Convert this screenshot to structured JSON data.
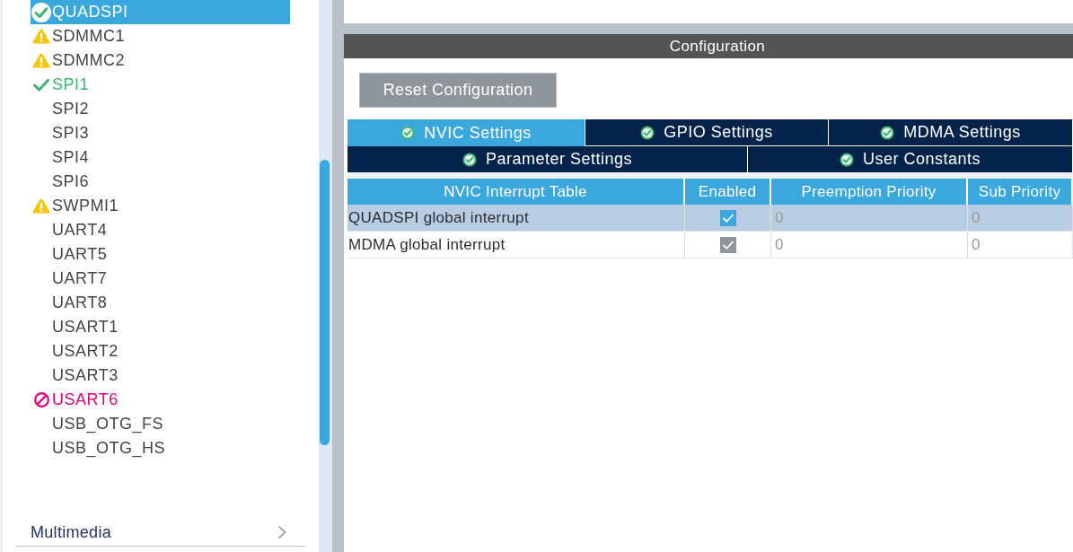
{
  "sidebar": {
    "items": [
      {
        "label": "QUADSPI",
        "kind": "ok",
        "selected": true
      },
      {
        "label": "SDMMC1",
        "kind": "warning",
        "selected": false
      },
      {
        "label": "SDMMC2",
        "kind": "warning",
        "selected": false
      },
      {
        "label": "SPI1",
        "kind": "ok",
        "selected": false
      },
      {
        "label": "SPI2",
        "kind": "plain",
        "selected": false
      },
      {
        "label": "SPI3",
        "kind": "plain",
        "selected": false
      },
      {
        "label": "SPI4",
        "kind": "plain",
        "selected": false
      },
      {
        "label": "SPI6",
        "kind": "plain",
        "selected": false
      },
      {
        "label": "SWPMI1",
        "kind": "warning",
        "selected": false
      },
      {
        "label": "UART4",
        "kind": "plain",
        "selected": false
      },
      {
        "label": "UART5",
        "kind": "plain",
        "selected": false
      },
      {
        "label": "UART7",
        "kind": "plain",
        "selected": false
      },
      {
        "label": "UART8",
        "kind": "plain",
        "selected": false
      },
      {
        "label": "USART1",
        "kind": "plain",
        "selected": false
      },
      {
        "label": "USART2",
        "kind": "plain",
        "selected": false
      },
      {
        "label": "USART3",
        "kind": "plain",
        "selected": false
      },
      {
        "label": "USART6",
        "kind": "blocked",
        "selected": false
      },
      {
        "label": "USB_OTG_FS",
        "kind": "plain",
        "selected": false
      },
      {
        "label": "USB_OTG_HS",
        "kind": "plain",
        "selected": false
      }
    ],
    "category": {
      "label": "Multimedia",
      "expanded": false
    }
  },
  "configuration": {
    "title": "Configuration",
    "reset_button": "Reset Configuration",
    "tab_rows": [
      {
        "tabs": [
          {
            "label": "NVIC Settings",
            "selected": true
          },
          {
            "label": "GPIO Settings",
            "selected": false
          },
          {
            "label": "MDMA Settings",
            "selected": false
          }
        ]
      },
      {
        "tabs": [
          {
            "label": "Parameter Settings",
            "selected": false
          },
          {
            "label": "User Constants",
            "selected": false
          }
        ]
      }
    ],
    "table": {
      "columns": [
        "NVIC Interrupt Table",
        "Enabled",
        "Preemption Priority",
        "Sub Priority"
      ],
      "rows": [
        {
          "name": "QUADSPI global interrupt",
          "enabled": {
            "checked": true,
            "disabled": false
          },
          "preemption_priority": "0",
          "sub_priority": "0",
          "selected": true
        },
        {
          "name": "MDMA global interrupt",
          "enabled": {
            "checked": true,
            "disabled": true
          },
          "preemption_priority": "0",
          "sub_priority": "0",
          "selected": false
        }
      ]
    }
  }
}
